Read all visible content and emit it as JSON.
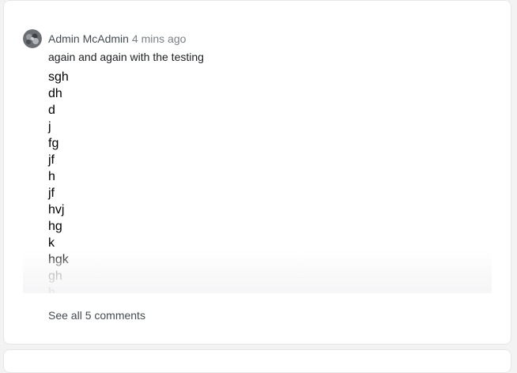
{
  "comment": {
    "author": "Admin McAdmin",
    "time": "4 mins ago",
    "first_line": "again and again with the testing",
    "lines": [
      "sgh",
      "dh",
      "d",
      "j",
      "fg",
      "jf",
      "h",
      "jf",
      "hvj",
      "hg",
      "k",
      "hgk",
      "gh",
      "h"
    ]
  },
  "footer": {
    "see_all_label": "See all 5 comments"
  }
}
